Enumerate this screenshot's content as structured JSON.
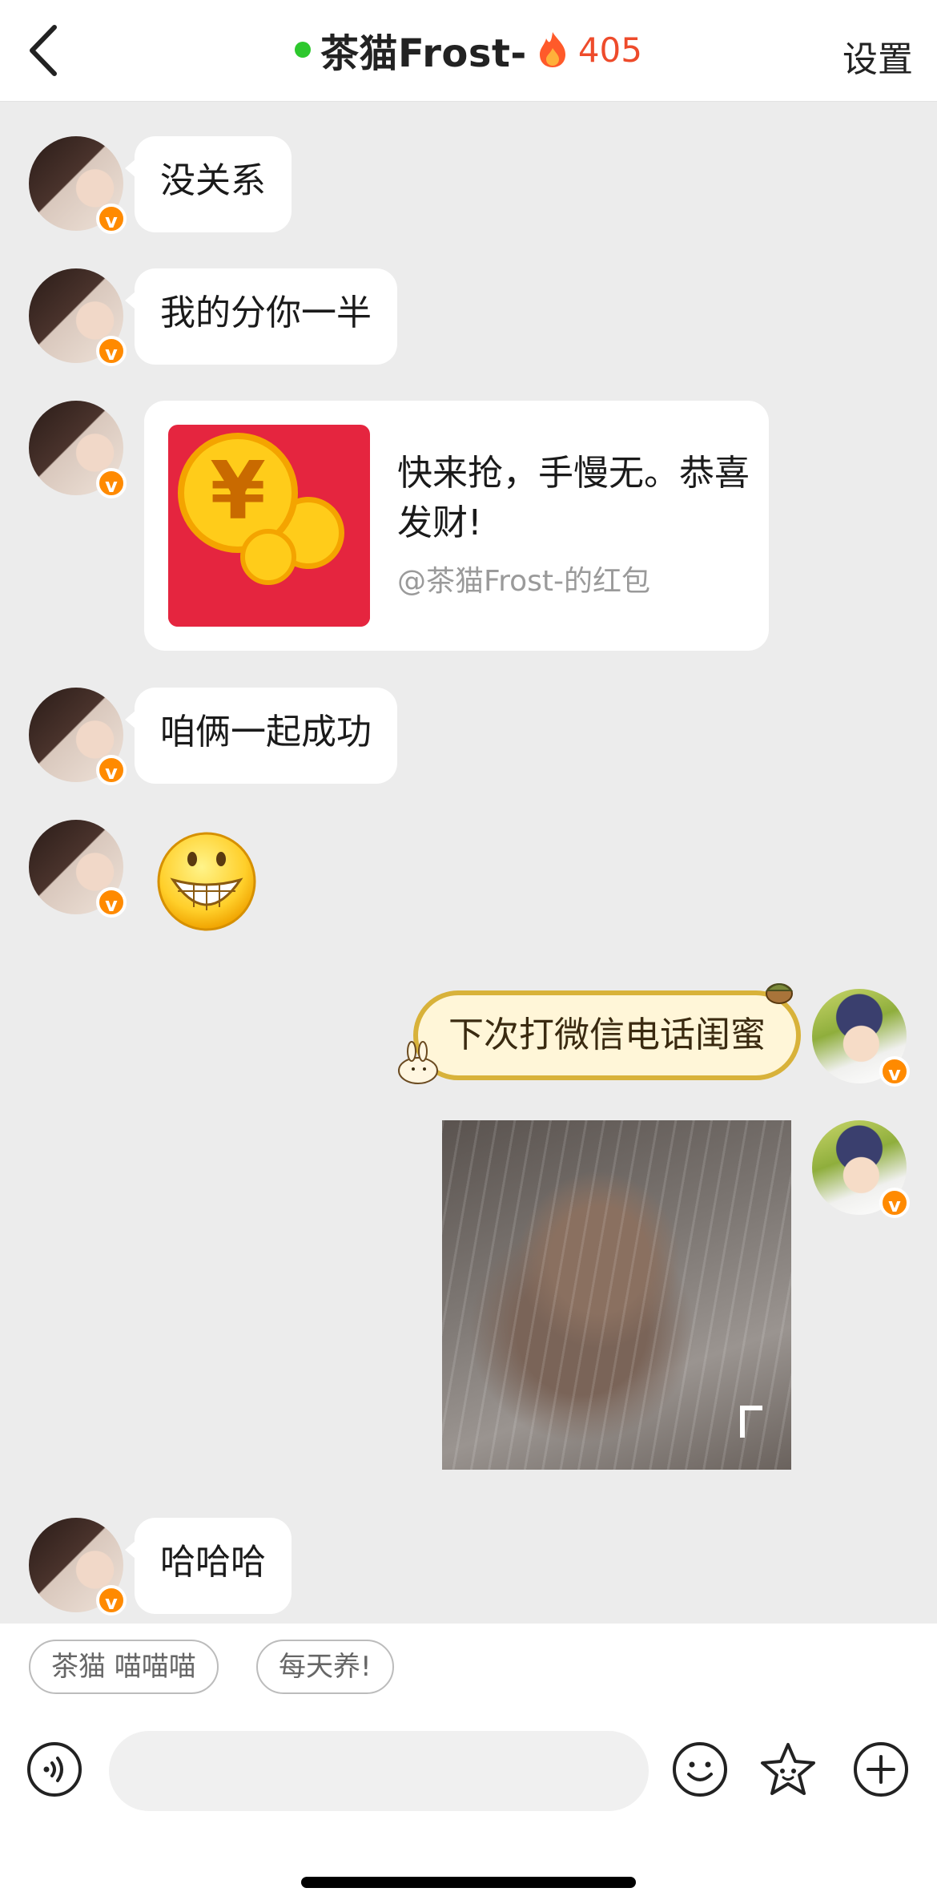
{
  "header": {
    "back_icon": "chevron-left-icon",
    "title": "茶猫Frost-",
    "online_color": "#2dc82d",
    "streak_icon": "fire-icon",
    "streak_count": "405",
    "streak_color": "#ee4b2b",
    "settings_label": "设置"
  },
  "messages": [
    {
      "side": "left",
      "type": "text",
      "text": "没关系"
    },
    {
      "side": "left",
      "type": "text",
      "text": "我的分你一半"
    },
    {
      "side": "left",
      "type": "red_packet",
      "text": "快来抢，手慢无。恭喜发财!",
      "from": "@茶猫Frost-的红包"
    },
    {
      "side": "left",
      "type": "text",
      "text": "咱俩一起成功"
    },
    {
      "side": "left",
      "type": "emoji",
      "icon": "grinning-face-emoji-icon"
    },
    {
      "side": "right",
      "type": "sticker_text",
      "text": "下次打微信电话闺蜜"
    },
    {
      "side": "right",
      "type": "image",
      "icon": "photo-thumbnail"
    },
    {
      "side": "left",
      "type": "text",
      "text": "哈哈哈"
    }
  ],
  "badge_text": "v",
  "quick_replies": [
    "茶猫 喵喵喵",
    "每天养!"
  ],
  "input_bar": {
    "placeholder": "",
    "voice_icon": "voice-input-icon",
    "emoji_icon": "smiley-icon",
    "sticker_icon": "star-face-icon",
    "more_icon": "plus-circle-icon"
  },
  "colors": {
    "background": "#ececec",
    "bubble": "#ffffff",
    "verified_badge": "#ff8a00",
    "red_packet": "#e5253f"
  }
}
